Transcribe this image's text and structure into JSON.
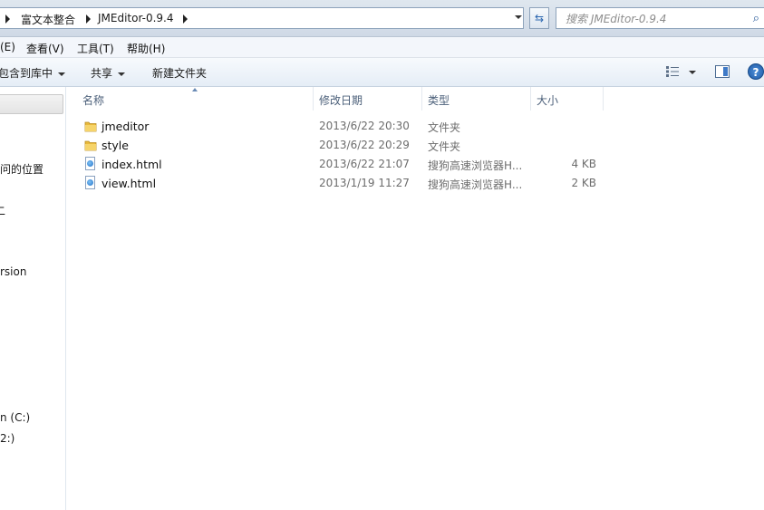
{
  "address": {
    "crumbs": [
      "富文本整合",
      "JMEditor-0.9.4"
    ],
    "search_placeholder": "搜索 JMEditor-0.9.4"
  },
  "menu": {
    "edit": "(E)",
    "view": "查看(V)",
    "tools": "工具(T)",
    "help": "帮助(H)"
  },
  "toolbar": {
    "include_library": "包含到库中",
    "share": "共享",
    "new_folder": "新建文件夹"
  },
  "nav": {
    "items": [
      "问的位置",
      "二",
      "rsion",
      "n (C:)",
      "2:)"
    ]
  },
  "columns": {
    "name": "名称",
    "modified": "修改日期",
    "type": "类型",
    "size": "大小"
  },
  "files": [
    {
      "name": "jmeditor",
      "modified": "2013/6/22 20:30",
      "type": "文件夹",
      "size": "",
      "icon": "folder-icon"
    },
    {
      "name": "style",
      "modified": "2013/6/22 20:29",
      "type": "文件夹",
      "size": "",
      "icon": "folder-icon"
    },
    {
      "name": "index.html",
      "modified": "2013/6/22 21:07",
      "type": "搜狗高速浏览器H...",
      "size": "4 KB",
      "icon": "html-file-icon"
    },
    {
      "name": "view.html",
      "modified": "2013/1/19 11:27",
      "type": "搜狗高速浏览器H...",
      "size": "2 KB",
      "icon": "html-file-icon"
    }
  ]
}
